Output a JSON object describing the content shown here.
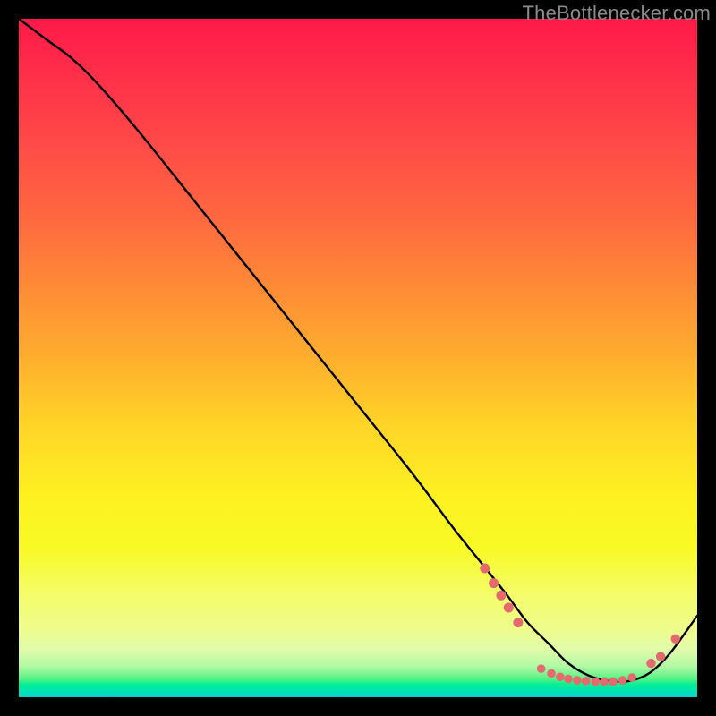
{
  "watermark": "TheBottlenecker.com",
  "colors": {
    "curve": "#000000",
    "marker_fill": "#e46a6d",
    "marker_stroke": "#c94f55"
  },
  "chart_data": {
    "type": "line",
    "title": "",
    "xlabel": "",
    "ylabel": "",
    "xlim": [
      0,
      100
    ],
    "ylim": [
      0,
      100
    ],
    "curve": {
      "x": [
        0,
        4,
        8,
        12,
        18,
        26,
        34,
        42,
        50,
        58,
        64,
        68,
        72,
        75,
        78,
        81,
        84,
        87,
        90,
        93,
        96,
        100
      ],
      "y": [
        100,
        97,
        94,
        90,
        83,
        73,
        63,
        53,
        43,
        33,
        25,
        20,
        15,
        11,
        8,
        5,
        3.2,
        2.4,
        2.4,
        3.6,
        6.5,
        12
      ]
    },
    "markers": [
      {
        "x": 68.7,
        "y": 19.0,
        "r": 5.5
      },
      {
        "x": 70.0,
        "y": 16.8,
        "r": 5.5
      },
      {
        "x": 71.1,
        "y": 15.0,
        "r": 5.5
      },
      {
        "x": 72.2,
        "y": 13.2,
        "r": 5.5
      },
      {
        "x": 73.6,
        "y": 11.0,
        "r": 5.5
      },
      {
        "x": 77.0,
        "y": 4.2,
        "r": 4.8
      },
      {
        "x": 78.5,
        "y": 3.5,
        "r": 4.8
      },
      {
        "x": 79.8,
        "y": 3.0,
        "r": 4.8
      },
      {
        "x": 81.0,
        "y": 2.7,
        "r": 4.8
      },
      {
        "x": 82.3,
        "y": 2.5,
        "r": 4.8
      },
      {
        "x": 83.6,
        "y": 2.4,
        "r": 4.8
      },
      {
        "x": 85.0,
        "y": 2.3,
        "r": 4.8
      },
      {
        "x": 86.3,
        "y": 2.3,
        "r": 4.8
      },
      {
        "x": 87.6,
        "y": 2.3,
        "r": 4.8
      },
      {
        "x": 89.0,
        "y": 2.5,
        "r": 4.8
      },
      {
        "x": 90.4,
        "y": 2.9,
        "r": 4.8
      },
      {
        "x": 93.2,
        "y": 5.0,
        "r": 5.2
      },
      {
        "x": 94.6,
        "y": 6.0,
        "r": 5.2
      },
      {
        "x": 96.8,
        "y": 8.6,
        "r": 5.2
      }
    ]
  }
}
